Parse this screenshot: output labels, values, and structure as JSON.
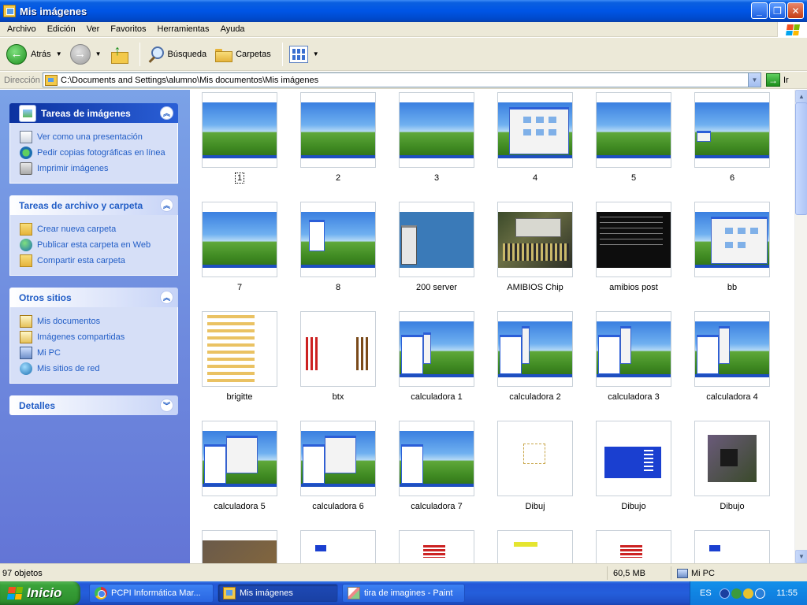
{
  "window": {
    "title": "Mis imágenes"
  },
  "menu": [
    "Archivo",
    "Edición",
    "Ver",
    "Favoritos",
    "Herramientas",
    "Ayuda"
  ],
  "toolbar": {
    "back": "Atrás",
    "search": "Búsqueda",
    "folders": "Carpetas"
  },
  "address": {
    "label": "Dirección",
    "path": "C:\\Documents and Settings\\alumno\\Mis documentos\\Mis imágenes",
    "go": "Ir"
  },
  "panels": {
    "images": {
      "title": "Tareas de imágenes",
      "items": [
        "Ver como una presentación",
        "Pedir copias fotográficas en línea",
        "Imprimir imágenes"
      ]
    },
    "files": {
      "title": "Tareas de archivo y carpeta",
      "items": [
        "Crear nueva carpeta",
        "Publicar esta carpeta en Web",
        "Compartir esta carpeta"
      ]
    },
    "places": {
      "title": "Otros sitios",
      "items": [
        "Mis documentos",
        "Imágenes compartidas",
        "Mi PC",
        "Mis sitios de red"
      ]
    },
    "details": {
      "title": "Detalles"
    }
  },
  "files": [
    "1",
    "2",
    "3",
    "4",
    "5",
    "6",
    "7",
    "8",
    "200 server",
    "AMIBIOS Chip",
    "amibios post",
    "bb",
    "brigitte",
    "btx",
    "calculadora 1",
    "calculadora 2",
    "calculadora 3",
    "calculadora 4",
    "calculadora 5",
    "calculadora 6",
    "calculadora 7",
    "Dibuj",
    "Dibujo",
    "Dibujo"
  ],
  "status": {
    "objects": "97 objetos",
    "size": "60,5 MB",
    "location": "Mi PC"
  },
  "taskbar": {
    "start": "Inicio",
    "tasks": [
      "PCPI Informática Mar...",
      "Mis imágenes",
      "tira de imagines - Paint"
    ],
    "language": "ES",
    "clock": "11:55"
  },
  "colors": {
    "titlebar": "#0055e5",
    "taskpane": "#6f8fe0",
    "link": "#215dc6",
    "start": "#3aa33a"
  }
}
